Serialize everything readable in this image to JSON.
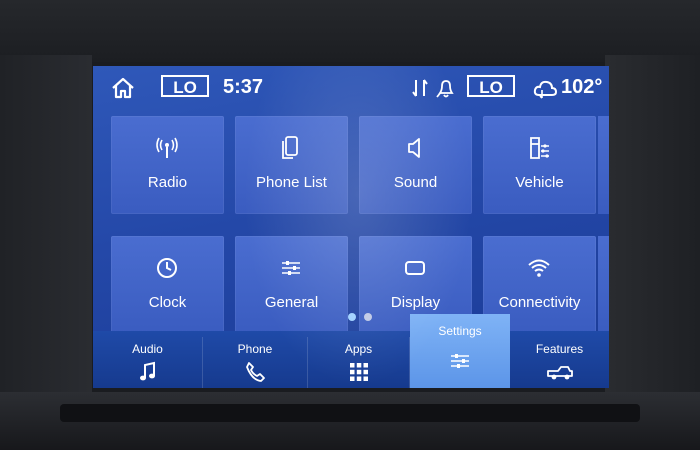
{
  "status": {
    "climate_left": "LO",
    "time": "5:37",
    "climate_right": "LO",
    "outside_temp": "102°"
  },
  "tiles": [
    {
      "label": "Radio",
      "icon": "radio-antenna-icon"
    },
    {
      "label": "Phone List",
      "icon": "phone-list-icon"
    },
    {
      "label": "Sound",
      "icon": "speaker-icon"
    },
    {
      "label": "Vehicle",
      "icon": "vehicle-settings-icon"
    },
    {
      "label": "Clock",
      "icon": "clock-icon"
    },
    {
      "label": "General",
      "icon": "sliders-icon"
    },
    {
      "label": "Display",
      "icon": "display-icon"
    },
    {
      "label": "Connectivity",
      "icon": "wifi-icon"
    }
  ],
  "pagination": {
    "pages": 2,
    "current": 1
  },
  "nav": [
    {
      "label": "Audio",
      "icon": "music-note-icon"
    },
    {
      "label": "Phone",
      "icon": "phone-icon"
    },
    {
      "label": "Apps",
      "icon": "apps-grid-icon"
    },
    {
      "label": "Settings",
      "icon": "settings-sliders-icon",
      "active": true
    },
    {
      "label": "Features",
      "icon": "truck-icon"
    }
  ],
  "colors": {
    "screen_bg": "#2a50b2",
    "tile_bg": "#4365c8",
    "nav_active": "#72a8f2",
    "text": "#ffffff"
  }
}
